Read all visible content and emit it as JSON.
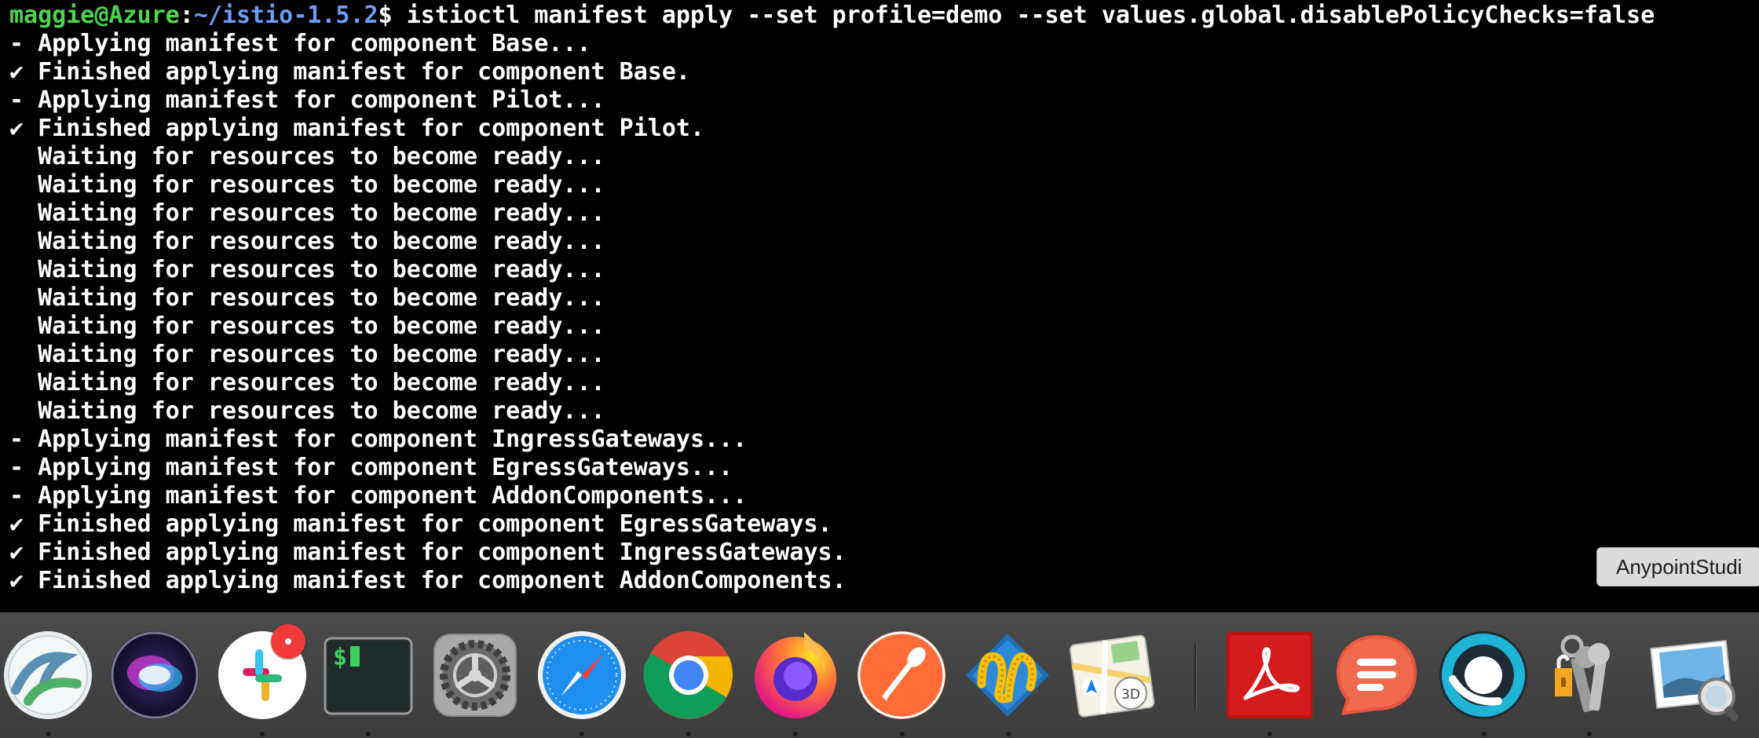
{
  "terminal": {
    "prompt": {
      "user_host": "maggie@Azure",
      "separator": ":",
      "path": "~/istio-1.5.2",
      "symbol": "$ ",
      "command": "istioctl manifest apply --set profile=demo --set values.global.disablePolicyChecks=false"
    },
    "lines": [
      "- Applying manifest for component Base...",
      "✔ Finished applying manifest for component Base.",
      "- Applying manifest for component Pilot...",
      "✔ Finished applying manifest for component Pilot.",
      "  Waiting for resources to become ready...",
      "  Waiting for resources to become ready...",
      "  Waiting for resources to become ready...",
      "  Waiting for resources to become ready...",
      "  Waiting for resources to become ready...",
      "  Waiting for resources to become ready...",
      "  Waiting for resources to become ready...",
      "  Waiting for resources to become ready...",
      "  Waiting for resources to become ready...",
      "  Waiting for resources to become ready...",
      "- Applying manifest for component IngressGateways...",
      "- Applying manifest for component EgressGateways...",
      "- Applying manifest for component AddonComponents...",
      "✔ Finished applying manifest for component EgressGateways.",
      "✔ Finished applying manifest for component IngressGateways.",
      "✔ Finished applying manifest for component AddonComponents."
    ]
  },
  "tooltip": {
    "text": "AnypointStudi"
  },
  "dock": {
    "apps": [
      {
        "icon": "cisco-anyconnect-icon",
        "running": true
      },
      {
        "icon": "siri-icon",
        "running": false
      },
      {
        "icon": "slack-icon",
        "running": true,
        "badge": true
      },
      {
        "icon": "terminal-icon",
        "running": true
      },
      {
        "icon": "system-preferences-icon",
        "running": false
      },
      {
        "icon": "safari-icon",
        "running": true
      },
      {
        "icon": "chrome-icon",
        "running": true
      },
      {
        "icon": "firefox-icon",
        "running": true
      },
      {
        "icon": "postman-icon",
        "running": true
      },
      {
        "icon": "anypoint-studio-icon",
        "running": true
      },
      {
        "icon": "maps-icon",
        "running": false
      },
      {
        "icon": "acrobat-reader-icon",
        "running": true
      },
      {
        "icon": "speeko-icon",
        "running": false
      },
      {
        "icon": "webex-icon",
        "running": true
      },
      {
        "icon": "keychain-access-icon",
        "running": true
      },
      {
        "icon": "preview-icon",
        "running": false
      }
    ]
  },
  "colors": {
    "terminal_bg": "#000000",
    "terminal_text": "#ffffff",
    "prompt_user": "#4fd34f",
    "prompt_path": "#6f9cf2",
    "dock_bg": "#444444"
  }
}
